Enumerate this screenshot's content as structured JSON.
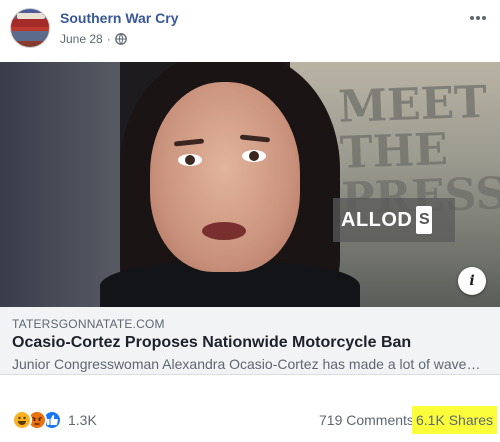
{
  "post": {
    "page_name": "Southern War Cry",
    "date": "June 28",
    "privacy_icon": "globe-icon",
    "more_icon": "ellipsis-icon"
  },
  "media": {
    "sign_text": "MEET THE PRESS",
    "watermark_text": "ALLOD",
    "watermark_badge": "S"
  },
  "link": {
    "domain": "TATERSGONNATATE.COM",
    "title": "Ocasio-Cortez Proposes Nationwide Motorcycle Ban",
    "description": "Junior Congresswoman Alexandra Ocasio-Cortez has made a lot of wave…"
  },
  "footer": {
    "reactions": [
      "haha",
      "angry",
      "like"
    ],
    "reaction_count": "1.3K",
    "comments": "719 Comments",
    "shares": "6.1K Shares",
    "shares_highlight_color": "#fbff3a"
  },
  "colors": {
    "page_name": "#385898",
    "like": "#1877f2",
    "haha": "#f7b125",
    "angry": "#e9710f"
  }
}
